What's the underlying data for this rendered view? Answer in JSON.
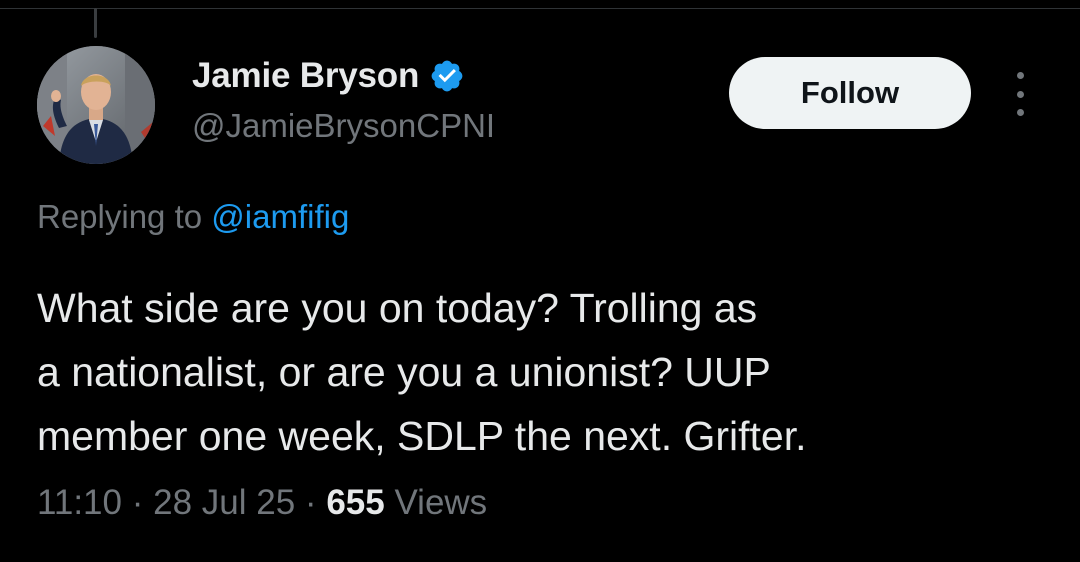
{
  "tweet": {
    "author": {
      "display_name": "Jamie Bryson",
      "handle": "@JamieBrysonCPNI",
      "verified": true,
      "verified_icon": "verified-badge-icon"
    },
    "follow_label": "Follow",
    "more_icon": "more-options-icon",
    "replying_to_prefix": "Replying to",
    "replying_to_handle": "@iamfifig",
    "text_lines": [
      "What side are you on today? Trolling as",
      "a nationalist, or are you a unionist? UUP",
      "member one week, SDLP the next. Grifter."
    ],
    "time": "11:10",
    "separator": "·",
    "date": "28 Jul 25",
    "views_count": "655",
    "views_label": "Views"
  },
  "colors": {
    "background": "#000000",
    "text_primary": "#e7e9ea",
    "text_secondary": "#71767b",
    "accent": "#1d9bf0",
    "follow_button_bg": "#eff3f4"
  }
}
